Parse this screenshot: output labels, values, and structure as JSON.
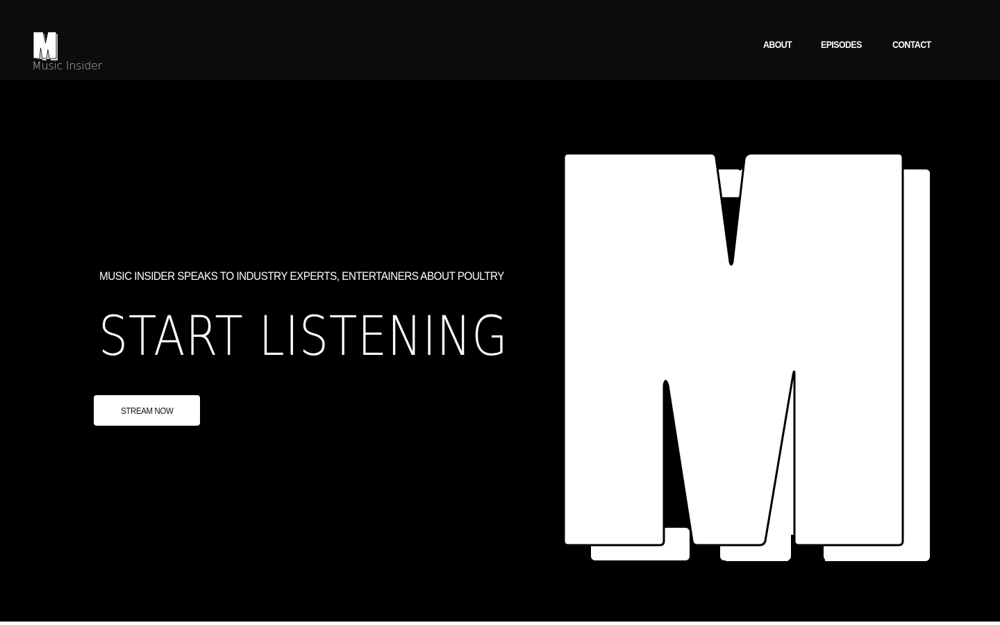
{
  "brand": {
    "name": "Music Insider",
    "logo_icon": "m-logo-icon"
  },
  "nav": {
    "items": [
      {
        "label": "ABOUT"
      },
      {
        "label": "EPISODES"
      },
      {
        "label": "CONTACT"
      }
    ]
  },
  "hero": {
    "tagline": "MUSIC INSIDER SPEAKS TO INDUSTRY EXPERTS, ENTERTAINERS ABOUT POULTRY",
    "headline": "START LISTENING",
    "cta_label": "STREAM NOW",
    "illustration_icon": "big-m-logo-icon"
  },
  "colors": {
    "header_bg": "#0c0c0c",
    "page_bg": "#000000",
    "text": "#ffffff",
    "brand_text": "#bdbdbd",
    "button_bg": "#ffffff"
  }
}
